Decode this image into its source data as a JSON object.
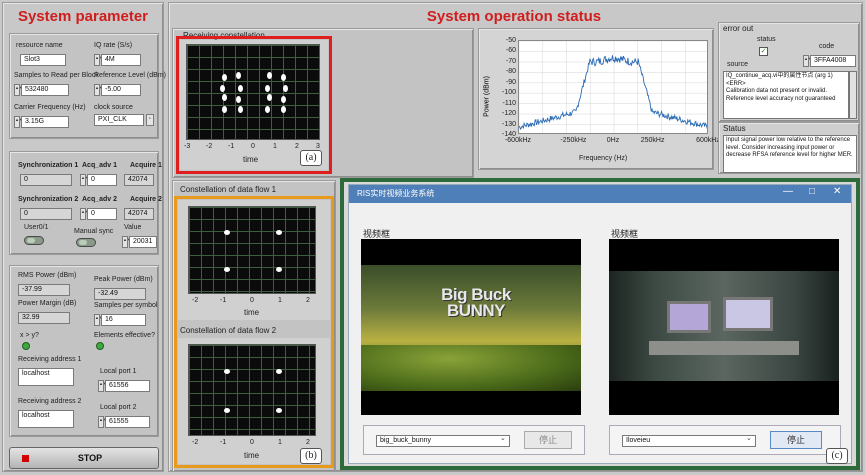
{
  "left": {
    "title": "System parameter",
    "resource_name_label": "resource name",
    "resource_name": "Slot3",
    "iq_rate_label": "IQ rate (S/s)",
    "iq_rate": "4M",
    "samples_label": "Samples to Read per Block",
    "samples": "532480",
    "ref_level_label": "Reference Level (dBm)",
    "ref_level": "-5.00",
    "carrier_label": "Carrier Frequency (Hz)",
    "carrier": "3.15G",
    "clock_label": "clock source",
    "clock": "PXI_CLK",
    "sync1_label": "Synchronization 1",
    "sync1": "0",
    "acq_adv1_label": "Acq_adv 1",
    "acq_adv1": "0",
    "acquire1_label": "Acquire 1",
    "acquire1": "42074",
    "sync2_label": "Synchronization 2",
    "sync2": "0",
    "acq_adv2_label": "Acq_adv 2",
    "acq_adv2": "0",
    "acquire2_label": "Acquire 2",
    "acquire2": "42074",
    "user_label": "User0/1",
    "manual_label": "Manual sync",
    "value_label": "Value",
    "value": "20031",
    "rms_label": "RMS Power (dBm)",
    "rms": "-37.99",
    "peak_label": "Peak Power (dBm)",
    "peak": "-32.49",
    "margin_label": "Power Margin (dB)",
    "margin": "32.99",
    "sps_label": "Samples per symbol",
    "sps": "16",
    "xy_label": "x > y?",
    "elements_label": "Elements effective?",
    "recv_addr1_label": "Receiving address 1",
    "recv_addr1": "localhost",
    "port1_label": "Local port 1",
    "port1": "61556",
    "recv_addr2_label": "Receiving address 2",
    "recv_addr2": "localhost",
    "port2_label": "Local port  2",
    "port2": "61555",
    "stop_label": "STOP"
  },
  "status": {
    "title": "System operation status",
    "rx_const_title": "Receiving constellation",
    "flow1_title": "Constellation of data flow 1",
    "flow2_title": "Constellation of data flow 2",
    "time_label": "time",
    "x_ticks": [
      "-3",
      "-2",
      "-1",
      "0",
      "1",
      "2",
      "3"
    ],
    "x_ticks_small": [
      "-2",
      "-1",
      "0",
      "1",
      "2"
    ],
    "cap_a": "(a)",
    "cap_b": "(b)",
    "cap_c": "(c)"
  },
  "spectrum": {
    "ylabel": "Power (dBm)",
    "xlabel": "Frequency (Hz)",
    "y_ticks": [
      "-50",
      "-60",
      "-70",
      "-80",
      "-90",
      "-100",
      "-110",
      "-120",
      "-130",
      "-140"
    ],
    "x_ticks": [
      "-600kHz",
      "-250kHz",
      "0Hz",
      "250kHz",
      "600kHz"
    ],
    "color": "#2a6bb5"
  },
  "error": {
    "title": "error out",
    "status_label": "status",
    "code_label": "code",
    "code": "3FFA4008",
    "source_label": "source",
    "source_text": "IQ_continue_acq.vi中的属性节点 (arg 1)\n<ERR>\nCalibration data not present or invalid.\nReference level accuracy not guaranteed",
    "status_title": "Status",
    "status_text": "Input signal power low relative to the reference level.  Consider increasing  input power or decrease RFSA reference level for higher MER."
  },
  "video": {
    "window_title": "RIS实时视频业务系统",
    "frame_label_1": "视频框",
    "frame_label_2": "视频框",
    "select_1": "big_buck_bunny",
    "select_2": "Iloveieu",
    "stop_1": "停止",
    "stop_2": "停止",
    "bunny_text": "Big Buck BUNNY"
  },
  "colors": {
    "frame_a": "#e01e1e",
    "frame_b": "#e89a1c",
    "frame_c": "#2d6b3c"
  },
  "constellations": {
    "rx_points": [
      [
        -1.3,
        1.0
      ],
      [
        -0.7,
        1.1
      ],
      [
        0.7,
        1.1
      ],
      [
        1.3,
        1.0
      ],
      [
        -1.4,
        0.3
      ],
      [
        -0.6,
        0.3
      ],
      [
        0.6,
        0.3
      ],
      [
        1.4,
        0.3
      ],
      [
        -1.3,
        -0.3
      ],
      [
        -0.7,
        -0.4
      ],
      [
        0.7,
        -0.3
      ],
      [
        1.3,
        -0.4
      ],
      [
        -1.3,
        -1.0
      ],
      [
        -0.6,
        -1.0
      ],
      [
        0.6,
        -1.0
      ],
      [
        1.3,
        -1.0
      ]
    ],
    "flow1_points": [
      [
        -0.8,
        0.85
      ],
      [
        0.8,
        0.85
      ],
      [
        -0.8,
        -0.85
      ],
      [
        0.8,
        -0.85
      ]
    ],
    "flow2_points": [
      [
        -0.8,
        0.85
      ],
      [
        0.8,
        0.85
      ],
      [
        -0.8,
        -0.85
      ],
      [
        0.8,
        -0.85
      ]
    ]
  }
}
